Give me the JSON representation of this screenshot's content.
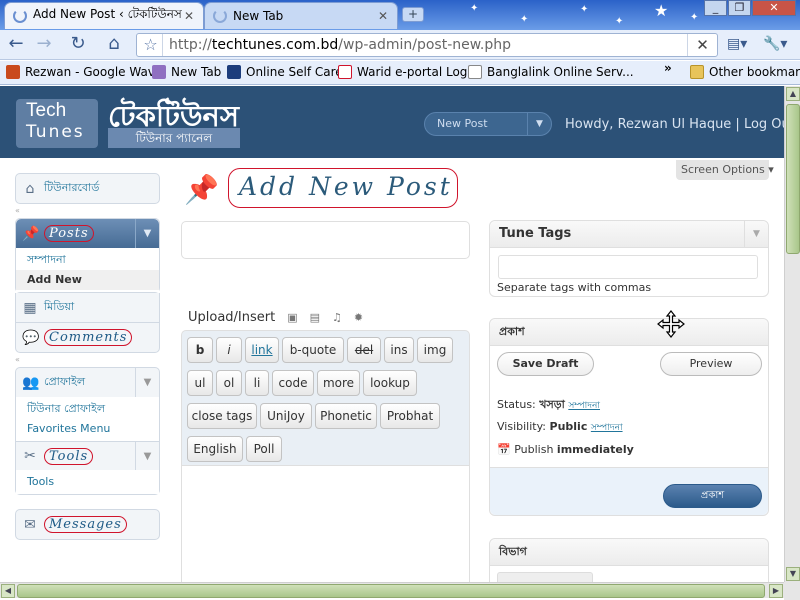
{
  "browser": {
    "tabs": [
      {
        "title": "Add New Post ‹ টেকটিউনস",
        "active": true
      },
      {
        "title": "New Tab",
        "active": false
      }
    ],
    "address": {
      "prefix": "http://",
      "domain": "techtunes.com.bd",
      "path": "/wp-admin/post-new.php"
    },
    "bookmarks": [
      {
        "label": "Rezwan - Google Wave",
        "icon": "wave-icon",
        "color": "#c94a1d"
      },
      {
        "label": "New Tab",
        "icon": "page-icon",
        "color": "#8f6fc1"
      },
      {
        "label": "Online Self Care",
        "icon": "selfcare-icon",
        "color": "#1d3d7c"
      },
      {
        "label": "Warid e-portal Login",
        "icon": "warid-icon",
        "color": "#d0142c"
      },
      {
        "label": "Banglalink Online Serv...",
        "icon": "page-icon",
        "color": "#888888"
      }
    ],
    "more_bookmarks": "»",
    "other_bookmarks": "Other bookmarks"
  },
  "site": {
    "logo_line1": "Tech",
    "logo_line2": "Tunes",
    "title": "টেকটিউনস",
    "subtitle": "টিউনার প্যানেল",
    "favorite_action": "New Post",
    "howdy": "Howdy, Rezwan Ul Haque | Log Out",
    "accent": "#2c5177"
  },
  "menu": {
    "dashboard": "টিউনারবোর্ড",
    "posts": "Posts",
    "posts_sub": [
      "সম্পাদনা",
      "Add New"
    ],
    "media": "মিডিয়া",
    "comments": "Comments",
    "profile": "প্রোফাইল",
    "profile_sub": [
      "টিউনার প্রোফাইল",
      "Favorites Menu"
    ],
    "tools": "Tools",
    "tools_sub": [
      "Tools"
    ],
    "messages": "Messages"
  },
  "page": {
    "title": "Add New Post",
    "screen_options": "Screen Options",
    "upload_insert": "Upload/Insert"
  },
  "quicktags": [
    "b",
    "i",
    "link",
    "b-quote",
    "del",
    "ins",
    "img",
    "ul",
    "ol",
    "li",
    "code",
    "more",
    "lookup",
    "close tags",
    "UniJoy",
    "Phonetic",
    "Probhat",
    "English",
    "Poll"
  ],
  "tags_box": {
    "title": "Tune Tags",
    "hint": "Separate tags with commas"
  },
  "publish_box": {
    "title": "প্রকাশ",
    "save_draft": "Save Draft",
    "preview": "Preview",
    "status_label": "Status:",
    "status_value": "খসড়া",
    "visibility_label": "Visibility:",
    "visibility_value": "Public",
    "edit_link": "সম্পাদনা",
    "publish_label": "Publish",
    "publish_value": "immediately",
    "publish_button": "প্রকাশ"
  },
  "category_box": {
    "title": "বিভাগ"
  }
}
